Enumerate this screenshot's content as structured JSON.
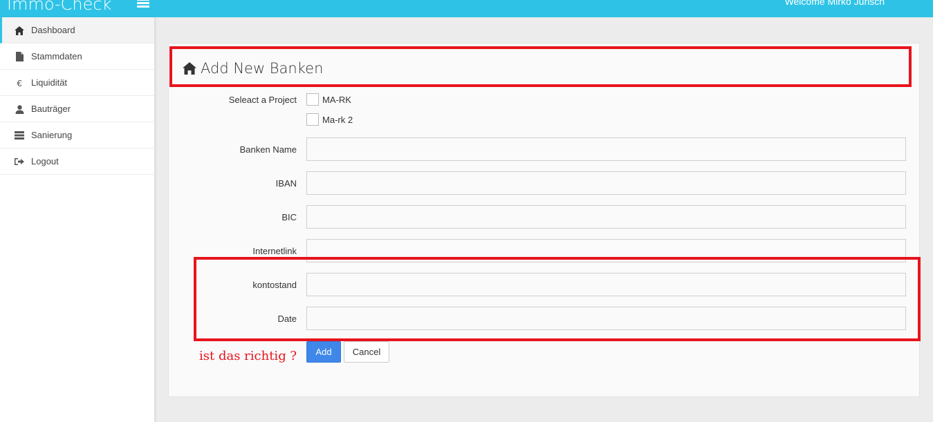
{
  "app": {
    "title": "Immo-Check",
    "welcome": "Welcome Mirko Jurisch"
  },
  "sidebar": {
    "items": [
      {
        "label": "Dashboard",
        "icon": "home-icon"
      },
      {
        "label": "Stammdaten",
        "icon": "file-icon"
      },
      {
        "label": "Liquidität",
        "icon": "euro-icon"
      },
      {
        "label": "Bauträger",
        "icon": "user-icon"
      },
      {
        "label": "Sanierung",
        "icon": "server-icon"
      },
      {
        "label": "Logout",
        "icon": "logout-icon"
      }
    ]
  },
  "form": {
    "title": "Add New Banken",
    "select_project_label": "Seleact a Project",
    "projects": [
      "MA-RK",
      "Ma-rk 2"
    ],
    "fields": {
      "banken_name": {
        "label": "Banken Name",
        "value": ""
      },
      "iban": {
        "label": "IBAN",
        "value": ""
      },
      "bic": {
        "label": "BIC",
        "value": ""
      },
      "internetlink": {
        "label": "Internetlink",
        "value": ""
      },
      "kontostand": {
        "label": "kontostand",
        "value": ""
      },
      "date": {
        "label": "Date",
        "value": ""
      }
    },
    "add_label": "Add",
    "cancel_label": "Cancel"
  },
  "annotation": {
    "text": "ist das richtig ?",
    "color": "#e8131c"
  },
  "colors": {
    "topbar": "#2ec3e6",
    "primary_button": "#3f87e8",
    "highlight": "#e8131c"
  }
}
